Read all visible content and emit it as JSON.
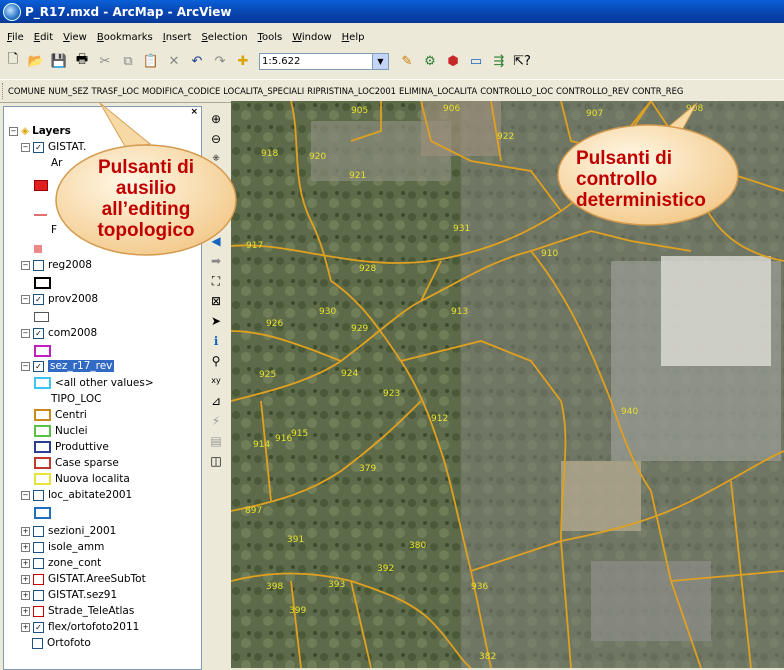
{
  "window": {
    "title": "P_R17.mxd - ArcMap - ArcView"
  },
  "menu": [
    "File",
    "Edit",
    "View",
    "Bookmarks",
    "Insert",
    "Selection",
    "Tools",
    "Window",
    "Help"
  ],
  "toolbar": {
    "scale": "1:5.622"
  },
  "custom_toolbar": [
    "COMUNE",
    "NUM_SEZ",
    "TRASF_LOC",
    "MODIFICA_CODICE",
    "LOCALITA_SPECIALI",
    "RIPRISTINA_LOC2001",
    "ELIMINA_LOCALITA",
    "CONTROLLO_LOC",
    "CONTROLLO_REV",
    "CONTR_REG"
  ],
  "toc": {
    "root": "Layers",
    "gistat_label": "GISTAT.",
    "gistat_sub1": "Ar",
    "gistat_sub2": "F",
    "reg": "reg2008",
    "prov": "prov2008",
    "com": "com2008",
    "sez": "sez_r17_rev",
    "all_other": "<all other values>",
    "tipo": "TIPO_LOC",
    "classes": [
      "Centri",
      "Nuclei",
      "Produttive",
      "Case sparse",
      "Nuova localita"
    ],
    "class_colors": [
      "#c78a1c",
      "#5bbf4a",
      "#2a3d8f",
      "#c0392b",
      "#e8e23a"
    ],
    "loc": "loc_abitate2001",
    "extra": [
      "sezioni_2001",
      "isole_amm",
      "zone_cont",
      "GISTAT.AreeSubTot",
      "GISTAT.sez91",
      "Strade_TeleAtlas",
      "flex/ortofoto2011",
      "Ortofoto"
    ]
  },
  "callouts": {
    "left": [
      "Pulsanti di",
      "ausilio",
      "all’editing",
      "topologico"
    ],
    "right": [
      "Pulsanti di",
      "controllo",
      "deterministico"
    ]
  },
  "map_labels": [
    "905",
    "906",
    "907",
    "908",
    "918",
    "920",
    "921",
    "922",
    "917",
    "928",
    "931",
    "910",
    "926",
    "930",
    "929",
    "913",
    "925",
    "924",
    "923",
    "912",
    "914",
    "916",
    "915",
    "940",
    "379",
    "897",
    "391",
    "380",
    "393",
    "392",
    "936",
    "398",
    "399",
    "382"
  ]
}
